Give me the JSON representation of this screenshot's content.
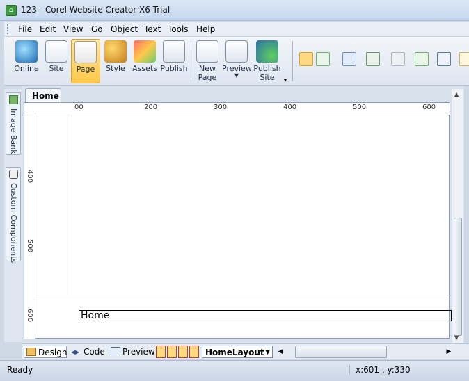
{
  "window": {
    "title": "123 - Corel Website Creator X6 Trial"
  },
  "menu": [
    "File",
    "Edit",
    "View",
    "Go",
    "Object",
    "Text",
    "Tools",
    "Help"
  ],
  "toolbar": {
    "buttons": [
      {
        "label": "Online"
      },
      {
        "label": "Site"
      },
      {
        "label": "Page"
      },
      {
        "label": "Style"
      },
      {
        "label": "Assets"
      },
      {
        "label": "Publish"
      },
      {
        "label": "New Page"
      },
      {
        "label": "Preview"
      },
      {
        "label": "Publish Site"
      }
    ]
  },
  "side_panel": {
    "tab1": "Image Bank",
    "tab2": "Custom Components"
  },
  "document": {
    "tab": "Home",
    "ruler_h": [
      "00",
      "200",
      "300",
      "400",
      "500",
      "600"
    ],
    "ruler_v": [
      "400",
      "500",
      "600"
    ],
    "footer_text": "Home"
  },
  "view_tabs": {
    "design": "Design",
    "code": "Code",
    "preview": "Preview"
  },
  "layout_select": "HomeLayout",
  "status": {
    "text": "Ready",
    "coords": "x:601 , y:330"
  }
}
